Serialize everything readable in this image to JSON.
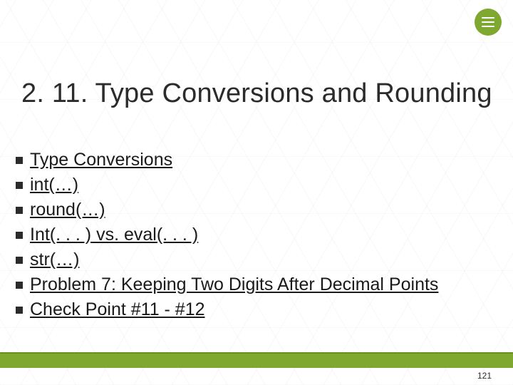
{
  "slide": {
    "title": "2. 11. Type Conversions and Rounding",
    "items": [
      {
        "label": "Type Conversions"
      },
      {
        "label": "int(…)"
      },
      {
        "label": "round(…)"
      },
      {
        "label": "Int(. . . ) vs. eval(. . . )"
      },
      {
        "label": "str(…)"
      },
      {
        "label": "Problem 7: Keeping Two Digits After Decimal Points"
      },
      {
        "label": "Check Point #11 - #12"
      }
    ],
    "page_number": "121"
  },
  "theme": {
    "accent": "#7fa830"
  }
}
